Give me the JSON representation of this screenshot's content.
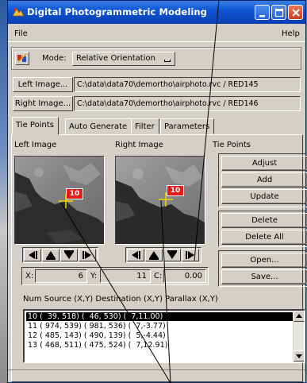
{
  "window": {
    "title": "Digital Photogrammetric Modeling",
    "title_icon": "app-icon",
    "controls": [
      "minimize-icon",
      "maximize-icon",
      "close-icon"
    ]
  },
  "menu": {
    "file": "File",
    "help": "Help"
  },
  "mode": {
    "label": "Mode:",
    "value": "Relative Orientation"
  },
  "images": {
    "left_button": "Left Image...",
    "left_path": "C:\\data\\data70\\demortho\\airphoto.rvc / RED145",
    "right_button": "Right Image...",
    "right_path": "C:\\data\\data70\\demortho\\airphoto.rvc / RED146"
  },
  "tabs": [
    "Tie Points",
    "Auto Generate",
    "Filter",
    "Parameters"
  ],
  "active_tab": "Tie Points",
  "panel": {
    "left_image_label": "Left Image",
    "right_image_label": "Right Image",
    "tie_points_label": "Tie Points",
    "left_marker": "10",
    "right_marker": "10"
  },
  "coords": {
    "x_label": "X:",
    "x_value": "6",
    "y_label": "Y:",
    "y_value": "11",
    "c_label": "C:",
    "c_value": "0.00"
  },
  "buttons": {
    "adjust": "Adjust",
    "add": "Add",
    "update": "Update",
    "delete": "Delete",
    "delete_all": "Delete All",
    "open": "Open...",
    "save": "Save..."
  },
  "list": {
    "header": "Num  Source (X,Y)  Destination (X,Y)  Parallax (X,Y)",
    "rows": [
      "10 (  39, 518) (  46, 530) (  7,11.00)",
      "11 ( 974, 539) ( 981, 536) (  7,-3.77)",
      "12 ( 485, 143) ( 490, 139) (  5,-4.44)",
      "13 ( 468, 511) ( 475, 524) (  7,12.91)"
    ],
    "selected_index": 0
  },
  "colors": {
    "title_bar": "#0a3fb0",
    "marker_red": "#e21b1b",
    "marker_cross": "#f2d500",
    "window_bg": "#d4d0c8"
  }
}
